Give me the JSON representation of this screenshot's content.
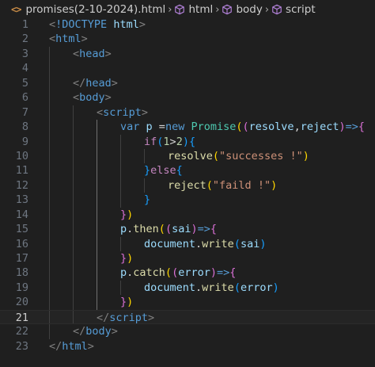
{
  "breadcrumb": {
    "file": "promises(2-10-2024).html",
    "file_icon": "<>",
    "items": [
      "html",
      "body",
      "script"
    ]
  },
  "colors": {
    "background": "#1f1f1f",
    "tag": "#569cd6",
    "string": "#ce9178",
    "function": "#dcdcaa",
    "variable": "#9cdcfe",
    "class": "#4ec9b0",
    "control": "#c586c0"
  },
  "editor": {
    "current_line": 21,
    "lines": [
      {
        "n": "1",
        "indent": 0,
        "tokens": [
          [
            "t-punct",
            "<"
          ],
          [
            "t-doctype",
            "!DOCTYPE"
          ],
          [
            "t-plain",
            " "
          ],
          [
            "t-var",
            "html"
          ],
          [
            "t-punct",
            ">"
          ]
        ]
      },
      {
        "n": "2",
        "indent": 0,
        "tokens": [
          [
            "t-punct",
            "<"
          ],
          [
            "t-tag",
            "html"
          ],
          [
            "t-punct",
            ">"
          ]
        ]
      },
      {
        "n": "3",
        "indent": 1,
        "tokens": [
          [
            "t-punct",
            "<"
          ],
          [
            "t-tag",
            "head"
          ],
          [
            "t-punct",
            ">"
          ]
        ]
      },
      {
        "n": "4",
        "indent": 1,
        "tokens": []
      },
      {
        "n": "5",
        "indent": 1,
        "tokens": [
          [
            "t-punct",
            "</"
          ],
          [
            "t-tag",
            "head"
          ],
          [
            "t-punct",
            ">"
          ]
        ]
      },
      {
        "n": "6",
        "indent": 1,
        "tokens": [
          [
            "t-punct",
            "<"
          ],
          [
            "t-tag",
            "body"
          ],
          [
            "t-punct",
            ">"
          ]
        ]
      },
      {
        "n": "7",
        "indent": 2,
        "tokens": [
          [
            "t-punct",
            "<"
          ],
          [
            "t-tag",
            "script"
          ],
          [
            "t-punct",
            ">"
          ]
        ]
      },
      {
        "n": "8",
        "indent": 3,
        "tokens": [
          [
            "t-keyword",
            "var"
          ],
          [
            "t-plain",
            " "
          ],
          [
            "t-var",
            "p"
          ],
          [
            "t-plain",
            " ="
          ],
          [
            "t-keyword",
            "new"
          ],
          [
            "t-plain",
            " "
          ],
          [
            "t-class",
            "Promise"
          ],
          [
            "b1",
            "("
          ],
          [
            "b2",
            "("
          ],
          [
            "t-var",
            "resolve"
          ],
          [
            "t-plain",
            ","
          ],
          [
            "t-var",
            "reject"
          ],
          [
            "b2",
            ")"
          ],
          [
            "t-keyword",
            "=>"
          ],
          [
            "b2",
            "{"
          ]
        ]
      },
      {
        "n": "9",
        "indent": 4,
        "tokens": [
          [
            "t-ctrl",
            "if"
          ],
          [
            "b3",
            "("
          ],
          [
            "t-num",
            "1"
          ],
          [
            "t-plain",
            ">"
          ],
          [
            "t-num",
            "2"
          ],
          [
            "b3",
            ")"
          ],
          [
            "b3",
            "{"
          ]
        ]
      },
      {
        "n": "10",
        "indent": 5,
        "tokens": [
          [
            "t-fn",
            "resolve"
          ],
          [
            "b1",
            "("
          ],
          [
            "t-string",
            "\"successes !\""
          ],
          [
            "b1",
            ")"
          ]
        ]
      },
      {
        "n": "11",
        "indent": 4,
        "tokens": [
          [
            "b3",
            "}"
          ],
          [
            "t-ctrl",
            "else"
          ],
          [
            "b3",
            "{"
          ]
        ]
      },
      {
        "n": "12",
        "indent": 5,
        "tokens": [
          [
            "t-fn",
            "reject"
          ],
          [
            "b1",
            "("
          ],
          [
            "t-string",
            "\"faild !\""
          ],
          [
            "b1",
            ")"
          ]
        ]
      },
      {
        "n": "13",
        "indent": 4,
        "tokens": [
          [
            "b3",
            "}"
          ]
        ]
      },
      {
        "n": "14",
        "indent": 3,
        "tokens": [
          [
            "b2",
            "}"
          ],
          [
            "b1",
            ")"
          ]
        ]
      },
      {
        "n": "15",
        "indent": 3,
        "tokens": [
          [
            "t-var",
            "p"
          ],
          [
            "t-plain",
            "."
          ],
          [
            "t-fn",
            "then"
          ],
          [
            "b1",
            "("
          ],
          [
            "b2",
            "("
          ],
          [
            "t-var",
            "sai"
          ],
          [
            "b2",
            ")"
          ],
          [
            "t-keyword",
            "=>"
          ],
          [
            "b2",
            "{"
          ]
        ]
      },
      {
        "n": "16",
        "indent": 4,
        "tokens": [
          [
            "t-var",
            "document"
          ],
          [
            "t-plain",
            "."
          ],
          [
            "t-fn",
            "write"
          ],
          [
            "b3",
            "("
          ],
          [
            "t-var",
            "sai"
          ],
          [
            "b3",
            ")"
          ]
        ]
      },
      {
        "n": "17",
        "indent": 3,
        "tokens": [
          [
            "b2",
            "}"
          ],
          [
            "b1",
            ")"
          ]
        ]
      },
      {
        "n": "18",
        "indent": 3,
        "tokens": [
          [
            "t-var",
            "p"
          ],
          [
            "t-plain",
            "."
          ],
          [
            "t-fn",
            "catch"
          ],
          [
            "b1",
            "("
          ],
          [
            "b2",
            "("
          ],
          [
            "t-var",
            "error"
          ],
          [
            "b2",
            ")"
          ],
          [
            "t-keyword",
            "=>"
          ],
          [
            "b2",
            "{"
          ]
        ]
      },
      {
        "n": "19",
        "indent": 4,
        "tokens": [
          [
            "t-var",
            "document"
          ],
          [
            "t-plain",
            "."
          ],
          [
            "t-fn",
            "write"
          ],
          [
            "b3",
            "("
          ],
          [
            "t-var",
            "error"
          ],
          [
            "b3",
            ")"
          ]
        ]
      },
      {
        "n": "20",
        "indent": 3,
        "tokens": [
          [
            "b2",
            "}"
          ],
          [
            "b1",
            ")"
          ]
        ]
      },
      {
        "n": "21",
        "indent": 2,
        "tokens": [
          [
            "t-punct",
            "</"
          ],
          [
            "t-tag",
            "script"
          ],
          [
            "t-punct",
            ">"
          ]
        ]
      },
      {
        "n": "22",
        "indent": 1,
        "tokens": [
          [
            "t-punct",
            "</"
          ],
          [
            "t-tag",
            "body"
          ],
          [
            "t-punct",
            ">"
          ]
        ]
      },
      {
        "n": "23",
        "indent": 0,
        "tokens": [
          [
            "t-punct",
            "</"
          ],
          [
            "t-tag",
            "html"
          ],
          [
            "t-punct",
            ">"
          ]
        ]
      }
    ]
  }
}
